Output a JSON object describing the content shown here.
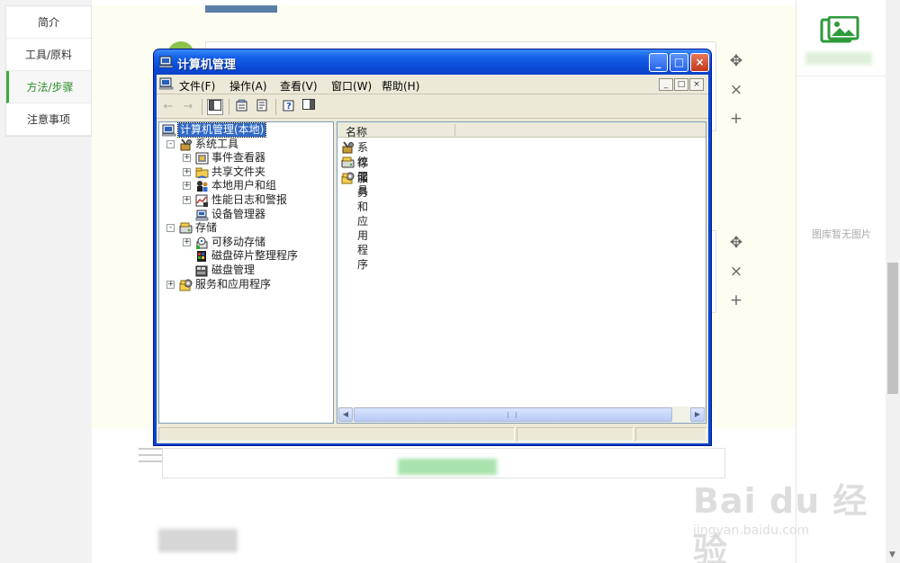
{
  "left_nav": {
    "items": [
      {
        "label": "简介",
        "active": false
      },
      {
        "label": "工具/原料",
        "active": false
      },
      {
        "label": "方法/步骤",
        "active": true
      },
      {
        "label": "注意事项",
        "active": false
      }
    ]
  },
  "right_panel": {
    "gallery_icon": "image-gallery-icon",
    "empty_text": "图库暂无图片"
  },
  "step_tools": {
    "move_icon": "✥",
    "delete_icon": "×",
    "add_icon": "+"
  },
  "window": {
    "title": "计算机管理",
    "menus": [
      "文件(F)",
      "操作(A)",
      "查看(V)",
      "窗口(W)",
      "帮助(H)"
    ],
    "caption_buttons": {
      "minimize": "_",
      "maximize": "□",
      "close": "×"
    },
    "tree": [
      {
        "label": "计算机管理(本地)",
        "level": 0,
        "expander": "",
        "icon": "computer-icon",
        "selected": true
      },
      {
        "label": "系统工具",
        "level": 1,
        "expander": "-",
        "icon": "system-tools-icon",
        "selected": false
      },
      {
        "label": "事件查看器",
        "level": 2,
        "expander": "+",
        "icon": "event-viewer-icon",
        "selected": false
      },
      {
        "label": "共享文件夹",
        "level": 2,
        "expander": "+",
        "icon": "shared-folder-icon",
        "selected": false
      },
      {
        "label": "本地用户和组",
        "level": 2,
        "expander": "+",
        "icon": "users-groups-icon",
        "selected": false
      },
      {
        "label": "性能日志和警报",
        "level": 2,
        "expander": "+",
        "icon": "performance-logs-icon",
        "selected": false
      },
      {
        "label": "设备管理器",
        "level": 2,
        "expander": "",
        "icon": "device-manager-icon",
        "selected": false
      },
      {
        "label": "存储",
        "level": 1,
        "expander": "-",
        "icon": "storage-icon",
        "selected": false
      },
      {
        "label": "可移动存储",
        "level": 2,
        "expander": "+",
        "icon": "removable-storage-icon",
        "selected": false
      },
      {
        "label": "磁盘碎片整理程序",
        "level": 2,
        "expander": "",
        "icon": "defrag-icon",
        "selected": false
      },
      {
        "label": "磁盘管理",
        "level": 2,
        "expander": "",
        "icon": "disk-management-icon",
        "selected": false
      },
      {
        "label": "服务和应用程序",
        "level": 1,
        "expander": "+",
        "icon": "services-apps-icon",
        "selected": false
      }
    ],
    "list": {
      "column_header": "名称",
      "rows": [
        {
          "label": "系统工具",
          "icon": "system-tools-icon"
        },
        {
          "label": "存储",
          "icon": "storage-icon"
        },
        {
          "label": "服务和应用程序",
          "icon": "services-apps-icon"
        }
      ]
    }
  },
  "watermark": {
    "main": "Bai du 经验",
    "sub": "jingyan.baidu.com"
  },
  "colors": {
    "xp_title_blue": "#0b4bd8",
    "xp_face": "#ece9d8",
    "selection_blue": "#316ac5",
    "nav_active_green": "#3bab3b",
    "close_red": "#c4361b"
  }
}
